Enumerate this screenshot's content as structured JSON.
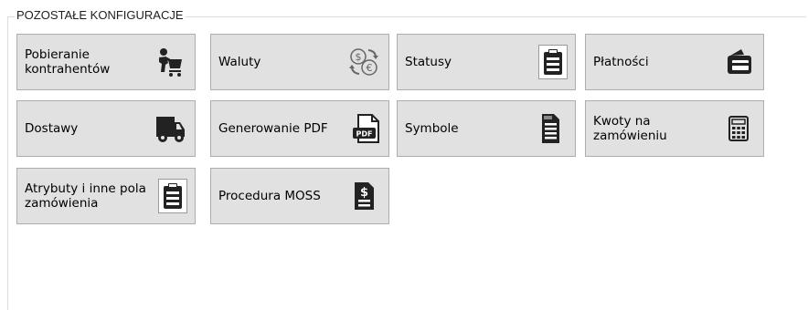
{
  "group": {
    "title": "POZOSTAŁE KONFIGURACJE"
  },
  "buttons": {
    "pobieranie": "Pobieranie\nkontrahentów",
    "waluty": "Waluty",
    "statusy": "Statusy",
    "platnosci": "Płatności",
    "dostawy": "Dostawy",
    "pdf": "Generowanie PDF",
    "symbole": "Symbole",
    "kwoty": "Kwoty na\nzamówieniu",
    "atrybuty": "Atrybuty i inne pola\nzamówienia",
    "moss": "Procedura MOSS"
  },
  "icons": {
    "pobieranie": "shopping-cart-person-icon",
    "waluty": "currency-exchange-icon",
    "statusy": "clipboard-checklist-icon",
    "platnosci": "wallet-icon",
    "dostawy": "delivery-truck-icon",
    "pdf": "pdf-file-icon",
    "symbole": "zip-file-list-icon",
    "kwoty": "calculator-icon",
    "atrybuty": "clipboard-checklist-icon",
    "moss": "dollar-document-icon",
    "pdf_badge": "PDF"
  },
  "colors": {
    "button_bg": "#e1e1e1",
    "button_border": "#adadad",
    "icon": "#222222"
  }
}
